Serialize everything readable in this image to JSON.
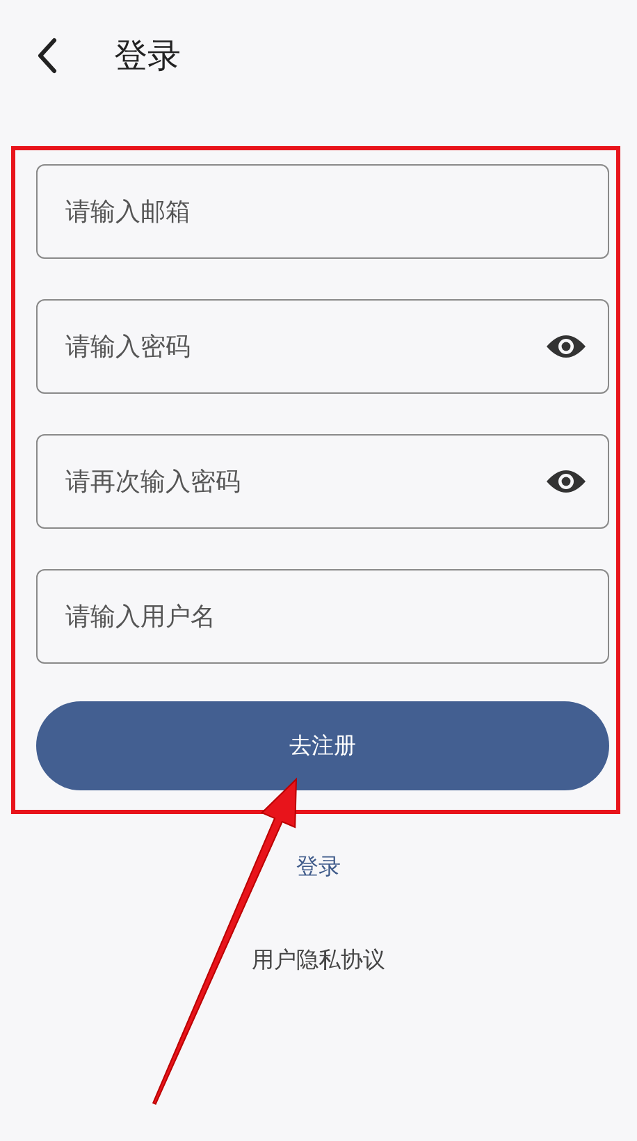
{
  "header": {
    "title": "登录"
  },
  "fields": [
    {
      "placeholder": "请输入邮箱",
      "kind": "text"
    },
    {
      "placeholder": "请输入密码",
      "kind": "password"
    },
    {
      "placeholder": "请再次输入密码",
      "kind": "password"
    },
    {
      "placeholder": "请输入用户名",
      "kind": "text"
    }
  ],
  "submit": {
    "label": "去注册"
  },
  "links": [
    {
      "label": "登录",
      "kind": "link"
    },
    {
      "label": "用户隐私协议",
      "kind": "plain"
    }
  ]
}
